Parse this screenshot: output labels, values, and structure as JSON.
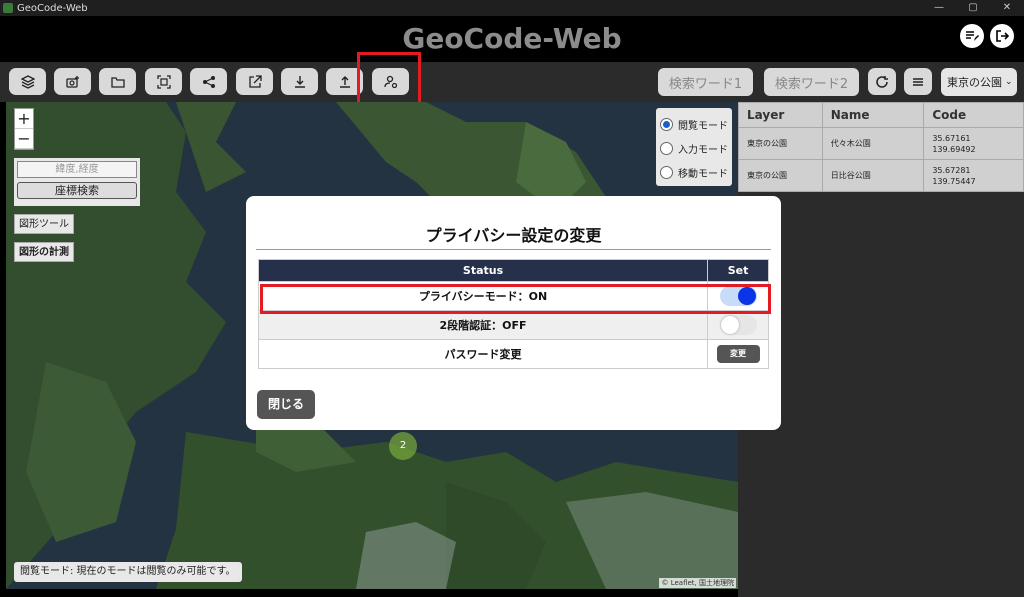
{
  "window": {
    "title": "GeoCode-Web",
    "controls": [
      "—",
      "▢",
      "✕"
    ]
  },
  "header": {
    "title": "GeoCode-Web",
    "icons": [
      "edit-list-icon",
      "logout-icon"
    ]
  },
  "toolbar": {
    "buttons": [
      "layers-icon",
      "add-photo-icon",
      "folder-icon",
      "qr-scan-icon",
      "share-icon",
      "open-external-icon",
      "download-icon",
      "upload-icon",
      "privacy-user-icon"
    ],
    "keyword1": "検索ワード1",
    "keyword2": "検索ワード2",
    "select_value": "東京の公園"
  },
  "map": {
    "zoom_in": "+",
    "zoom_out": "−",
    "coord_placeholder": "緯度,経度",
    "coord_search": "座標検索",
    "shape_tool": "図形ツール",
    "shape_measure": "図形の計測",
    "modes": [
      {
        "label": "閲覧モード",
        "selected": true
      },
      {
        "label": "入力モード",
        "selected": false
      },
      {
        "label": "移動モード",
        "selected": false
      }
    ],
    "cluster_count": "2",
    "status": "閲覧モード: 現在のモードは閲覧のみ可能です。",
    "attribution": "© Leaflet, 国土地理院"
  },
  "results": {
    "headers": [
      "Layer",
      "Name",
      "Code"
    ],
    "rows": [
      {
        "layer": "東京の公園",
        "name": "代々木公園",
        "code1": "35.67161",
        "code2": "139.69492"
      },
      {
        "layer": "東京の公園",
        "name": "日比谷公園",
        "code1": "35.67281",
        "code2": "139.75447"
      }
    ]
  },
  "modal": {
    "title": "プライバシー設定の変更",
    "col_status": "Status",
    "col_set": "Set",
    "rows": [
      {
        "label": "プライバシーモード：ON",
        "control": "toggle",
        "on": true
      },
      {
        "label": "2段階認証：OFF",
        "control": "toggle",
        "on": false
      },
      {
        "label": "パスワード変更",
        "control": "button",
        "button_label": "変更"
      }
    ],
    "close": "閉じる"
  },
  "colors": {
    "highlight": "#e31b23",
    "table_header": "#27304a",
    "toggle_on": "#0a35e6"
  }
}
